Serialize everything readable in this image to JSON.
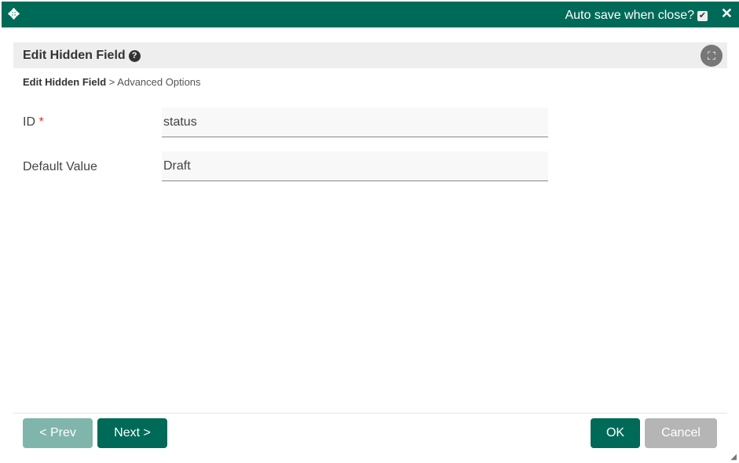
{
  "titlebar": {
    "autosave_label": "Auto save when close?",
    "autosave_checked": true
  },
  "header": {
    "title": "Edit Hidden Field"
  },
  "breadcrumb": {
    "current": "Edit Hidden Field",
    "separator": ">",
    "next": "Advanced Options"
  },
  "fields": [
    {
      "label": "ID",
      "required_mark": "*",
      "value": "status"
    },
    {
      "label": "Default Value",
      "value": "Draft"
    }
  ],
  "buttons": {
    "prev": "< Prev",
    "next": "Next >",
    "ok": "OK",
    "cancel": "Cancel"
  }
}
